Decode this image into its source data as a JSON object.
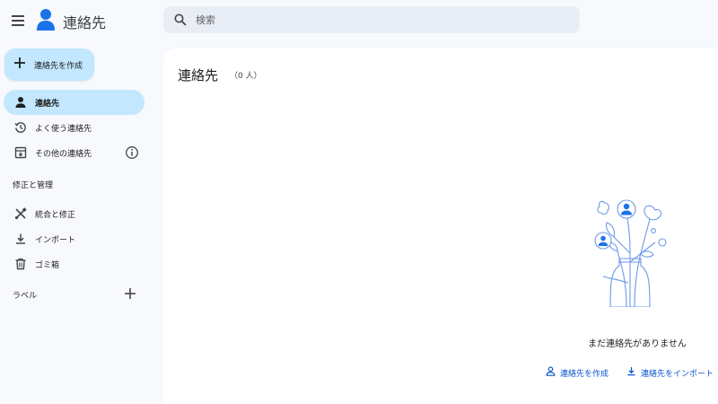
{
  "header": {
    "app_title": "連絡先",
    "search_placeholder": "検索"
  },
  "sidebar": {
    "create_label": "連絡先を作成",
    "items": [
      {
        "label": "連絡先",
        "icon": "person-icon",
        "active": true
      },
      {
        "label": "よく使う連絡先",
        "icon": "history-icon"
      },
      {
        "label": "その他の連絡先",
        "icon": "archive-icon"
      }
    ],
    "manage_heading": "修正と管理",
    "manage_items": [
      {
        "label": "統合と修正",
        "icon": "tools-icon"
      },
      {
        "label": "インポート",
        "icon": "download-icon"
      },
      {
        "label": "ゴミ箱",
        "icon": "trash-icon"
      }
    ],
    "labels_heading": "ラベル"
  },
  "main": {
    "title": "連絡先",
    "count": "（0 人）",
    "empty_message": "まだ連絡先がありません",
    "create_link": "連絡先を作成",
    "import_link": "連絡先をインポート"
  },
  "colors": {
    "accent": "#0b57d0",
    "active_bg": "#c2e7ff",
    "search_bg": "#e9eef6",
    "logo_blue": "#1a73e8",
    "illustration_line": "#6d9ae8"
  }
}
